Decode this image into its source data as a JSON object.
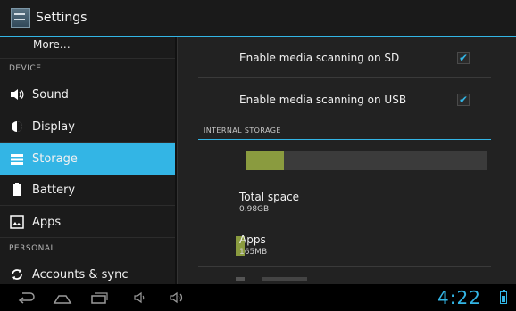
{
  "window": {
    "title": "Settings"
  },
  "sidebar": {
    "more_label": "More…",
    "sections": [
      {
        "header": "DEVICE"
      },
      {
        "header": "PERSONAL"
      }
    ],
    "items": [
      {
        "label": "Sound",
        "icon": "speaker-icon",
        "selected": false
      },
      {
        "label": "Display",
        "icon": "brightness-icon",
        "selected": false
      },
      {
        "label": "Storage",
        "icon": "storage-icon",
        "selected": true
      },
      {
        "label": "Battery",
        "icon": "battery-icon",
        "selected": false
      },
      {
        "label": "Apps",
        "icon": "apps-icon",
        "selected": false
      },
      {
        "label": "Accounts & sync",
        "icon": "sync-icon",
        "selected": false
      }
    ]
  },
  "main": {
    "options": [
      {
        "label": "Enable media scanning on SD",
        "checked": true
      },
      {
        "label": "Enable media scanning on USB",
        "checked": true
      }
    ],
    "internal_storage": {
      "header": "INTERNAL STORAGE",
      "used_fraction": 0.16,
      "rows": [
        {
          "title": "Total space",
          "value": "0.98GB"
        },
        {
          "title": "Apps",
          "value": "165MB"
        }
      ],
      "apps_color": "#8a9b3f"
    }
  },
  "navbar": {
    "icons": [
      "back-icon",
      "home-icon",
      "recent-apps-icon",
      "volume-down-icon",
      "volume-up-icon"
    ],
    "clock": "4:22",
    "accent": "#33b5e5"
  }
}
